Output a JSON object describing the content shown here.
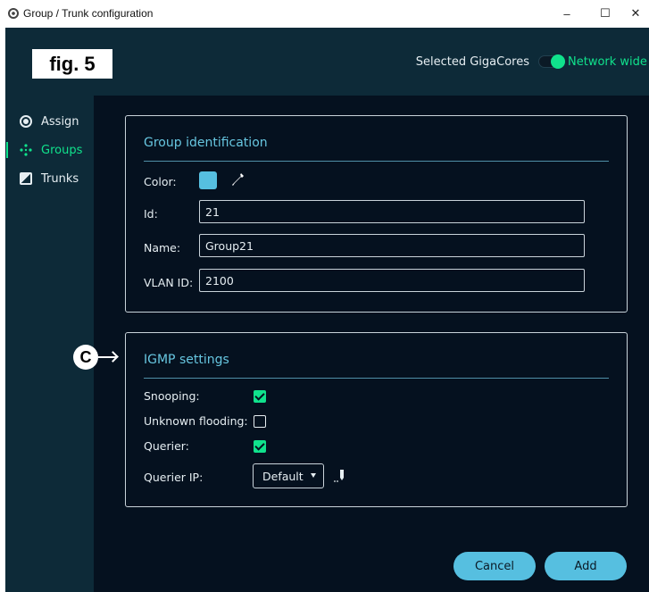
{
  "window": {
    "title": "Group / Trunk configuration",
    "minimize": "–",
    "maximize": "☐",
    "close": "✕"
  },
  "header": {
    "fig_label": "fig. 5",
    "selected_label": "Selected GigaCores",
    "network_label": "Network wide",
    "toggle_on": true
  },
  "sidebar": {
    "items": [
      {
        "label": "Assign",
        "icon": "radio-icon"
      },
      {
        "label": "Groups",
        "icon": "groups-icon",
        "active": true
      },
      {
        "label": "Trunks",
        "icon": "trunk-icon"
      }
    ]
  },
  "group_identification": {
    "title": "Group identification",
    "color_label": "Color:",
    "color_value": "#56bfe0",
    "id_label": "Id:",
    "id_value": "21",
    "name_label": "Name:",
    "name_value": "Group21",
    "vlan_label": "VLAN ID:",
    "vlan_value": "2100"
  },
  "igmp": {
    "title": "IGMP settings",
    "snooping_label": "Snooping:",
    "snooping_checked": true,
    "unknown_label": "Unknown flooding:",
    "unknown_checked": false,
    "querier_label": "Querier:",
    "querier_checked": true,
    "querier_ip_label": "Querier IP:",
    "querier_ip_value": "Default"
  },
  "annotation": {
    "c_badge": "C"
  },
  "actions": {
    "cancel_label": "Cancel",
    "add_label": "Add"
  },
  "colors": {
    "accent": "#10e28c",
    "button": "#56bfe0",
    "title": "#67c6e0",
    "background": "#05111f",
    "panel_header": "#0d2a38"
  }
}
